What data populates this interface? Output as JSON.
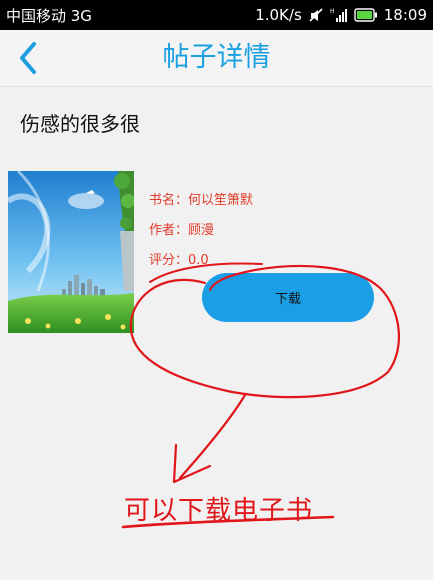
{
  "status_bar": {
    "carrier": "中国移动 3G",
    "net_speed": "1.0K/s",
    "time": "18:09",
    "icons": [
      "mute-icon",
      "signal-icon",
      "battery-icon"
    ]
  },
  "header": {
    "title": "帖子详情",
    "back_icon": "chevron-left-icon"
  },
  "post": {
    "title": "伤感的很多很"
  },
  "book": {
    "name_line": "书名：何以笙箫默",
    "author_line": "作者：顾漫",
    "rating_line": "评分：0.0",
    "download_label": "下载"
  },
  "annotation": {
    "text": "可以下载电子书",
    "color": "#e0161b"
  },
  "colors": {
    "accent": "#1a9fe0",
    "info_text": "#e23a2a",
    "button": "#1a9fe6"
  }
}
